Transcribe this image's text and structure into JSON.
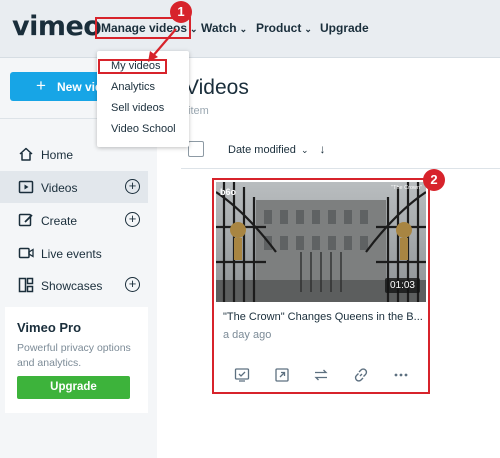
{
  "header": {
    "logo": "vimeo",
    "nav": {
      "manage": "Manage videos",
      "watch": "Watch",
      "product": "Product",
      "upgrade": "Upgrade"
    }
  },
  "annotations": {
    "step1": "1",
    "step2": "2"
  },
  "dropdown": {
    "items": [
      "My videos",
      "Analytics",
      "Sell videos",
      "Video School"
    ]
  },
  "new_video_button": "New video",
  "sidebar": {
    "items": [
      {
        "label": "Home",
        "icon": "home-icon"
      },
      {
        "label": "Videos",
        "icon": "videos-icon",
        "active": true
      },
      {
        "label": "Create",
        "icon": "create-icon"
      },
      {
        "label": "Live events",
        "icon": "live-events-icon"
      },
      {
        "label": "Showcases",
        "icon": "showcases-icon"
      }
    ],
    "pro": {
      "title": "Vimeo Pro",
      "description": "Powerful privacy options and analytics.",
      "button": "Upgrade"
    }
  },
  "main": {
    "title": "Videos",
    "count": "item",
    "sort_label": "Date modified"
  },
  "video": {
    "title": "\"The Crown\" Changes Queens in the B...",
    "date": "a day ago",
    "duration": "01:03",
    "thumb_tag": "b6o",
    "thumb_tag2": "\"The Crown\""
  },
  "colors": {
    "accent_blue": "#17a5e6",
    "upgrade_green": "#3db33b",
    "annotation_red": "#d7232b"
  }
}
